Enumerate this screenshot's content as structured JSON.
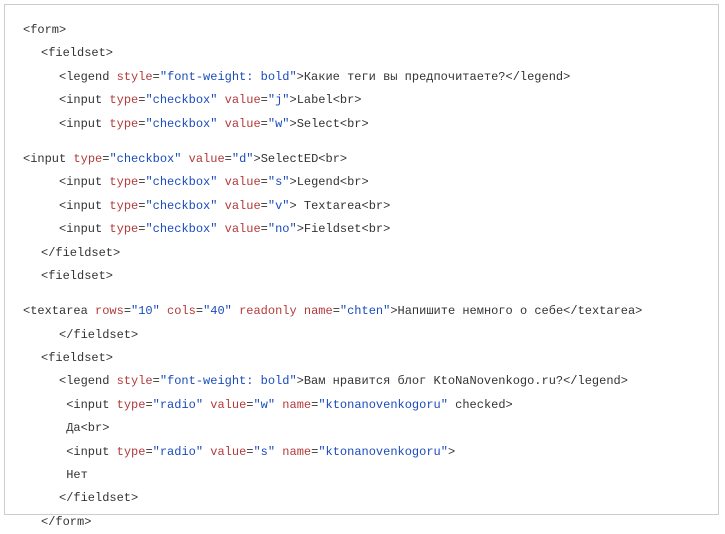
{
  "lines": {
    "l1": {
      "open": "<form>"
    },
    "l2": {
      "open": "<fieldset>"
    },
    "l3": {
      "open": "<legend ",
      "a1n": "style",
      "a1v": "\"font-weight: bold\"",
      "mid": ">",
      "text": "Какие теги вы предпочитаете?",
      "close": "</legend>"
    },
    "l4": {
      "open": "<input ",
      "a1n": "type",
      "a1v": "\"checkbox\"",
      "a2n": "value",
      "a2v": "\"j\"",
      "mid": ">",
      "text": "Label",
      "close": "<br>"
    },
    "l5": {
      "open": "<input ",
      "a1n": "type",
      "a1v": "\"checkbox\"",
      "a2n": "value",
      "a2v": "\"w\"",
      "mid": ">",
      "text": "Select",
      "close": "<br>"
    },
    "l6": {
      "open": "<input ",
      "a1n": "type",
      "a1v": "\"checkbox\"",
      "a2n": "value",
      "a2v": "\"d\"",
      "mid": ">",
      "text": "SelectED",
      "close": "<br>"
    },
    "l7": {
      "open": "<input ",
      "a1n": "type",
      "a1v": "\"checkbox\"",
      "a2n": "value",
      "a2v": "\"s\"",
      "mid": ">",
      "text": "Legend",
      "close": "<br>"
    },
    "l8": {
      "open": "<input ",
      "a1n": "type",
      "a1v": "\"checkbox\"",
      "a2n": "value",
      "a2v": "\"v\"",
      "mid": ">",
      "text": " Textarea",
      "close": "<br>"
    },
    "l9": {
      "open": "<input ",
      "a1n": "type",
      "a1v": "\"checkbox\"",
      "a2n": "value",
      "a2v": "\"no\"",
      "mid": ">",
      "text": "Fieldset",
      "close": "<br>"
    },
    "l10": {
      "open": "</fieldset>"
    },
    "l11": {
      "open": "<fieldset>"
    },
    "l12": {
      "open": "<textarea ",
      "a1n": "rows",
      "a1v": "\"10\"",
      "a2n": "cols",
      "a2v": "\"40\"",
      "a3n": "readonly name",
      "a3v": "\"chten\"",
      "mid": ">",
      "text": "Напишите немного о себе",
      "close": "</textarea>"
    },
    "l13": {
      "open": "</fieldset>"
    },
    "l14": {
      "open": "<fieldset>"
    },
    "l15": {
      "open": "<legend ",
      "a1n": "style",
      "a1v": "\"font-weight: bold\"",
      "mid": ">",
      "text": "Вам нравится блог KtoNaNovenkogo.ru?",
      "close": "</legend>"
    },
    "l16": {
      "open": "<input ",
      "a1n": "type",
      "a1v": "\"radio\"",
      "a2n": "value",
      "a2v": "\"w\"",
      "a3n": "name",
      "a3v": "\"ktonanovenkogoru\"",
      "tail": " checked>"
    },
    "l17": {
      "open": "Да<br>"
    },
    "l18": {
      "open": "<input ",
      "a1n": "type",
      "a1v": "\"radio\"",
      "a2n": "value",
      "a2v": "\"s\"",
      "a3n": "name",
      "a3v": "\"ktonanovenkogoru\"",
      "tail": ">"
    },
    "l19": {
      "open": "Нет"
    },
    "l20": {
      "open": "</fieldset>"
    },
    "l21": {
      "open": "</form>"
    }
  }
}
